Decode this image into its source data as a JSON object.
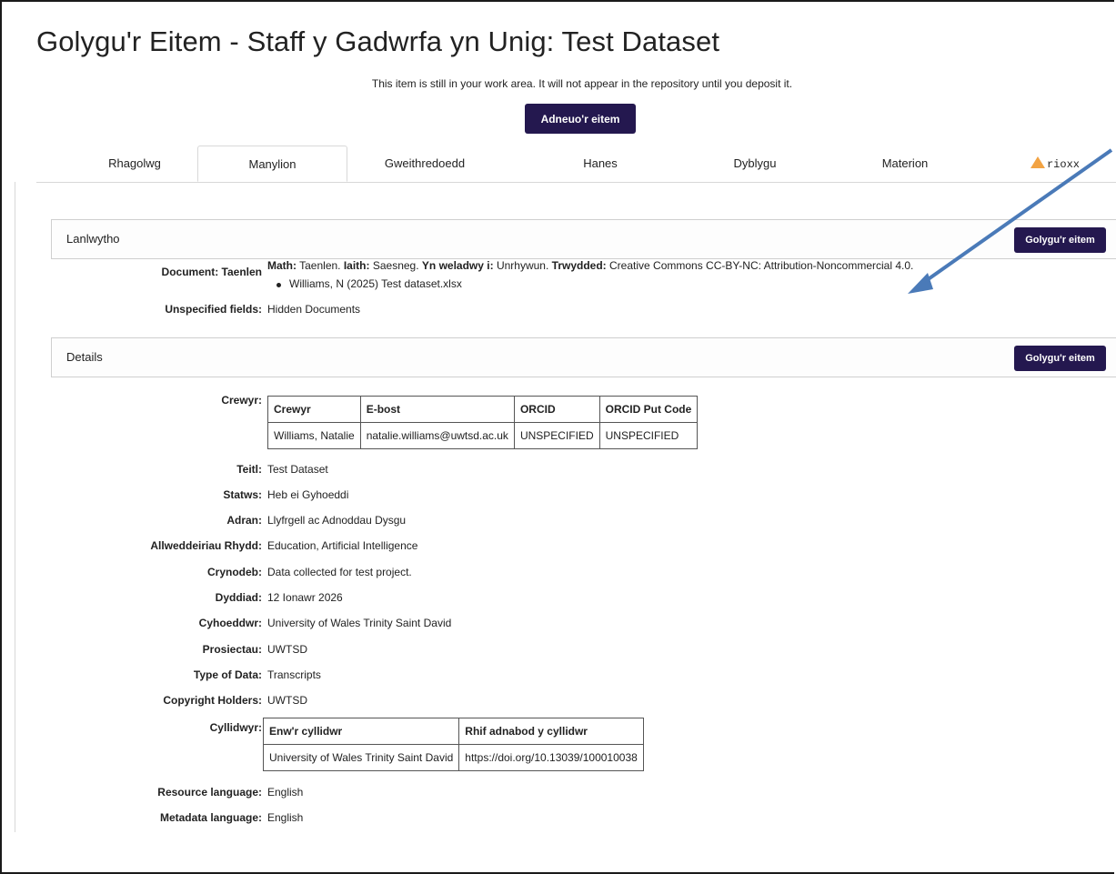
{
  "page": {
    "title": "Golygu'r Eitem - Staff y Gadwrfa yn Unig: Test Dataset",
    "notice": "This item is still in your work area. It will not appear in the repository until you deposit it.",
    "deposit_label": "Adneuo'r eitem"
  },
  "tabs": [
    {
      "label": "Rhagolwg"
    },
    {
      "label": "Manylion",
      "active": true
    },
    {
      "label": "Gweithredoedd"
    },
    {
      "label": "Hanes"
    },
    {
      "label": "Dyblygu"
    },
    {
      "label": "Materion"
    },
    {
      "label": "rioxx",
      "icon": "warning-icon"
    }
  ],
  "upload_panel": {
    "title": "Lanlwytho",
    "edit_label": "Golygu'r eitem",
    "document_label": "Document: Taenlen",
    "doc_line": {
      "math_label": "Math:",
      "math_value": "Taenlen.",
      "iaith_label": "Iaith:",
      "iaith_value": "Saesneg.",
      "visible_label": "Yn weladwy i:",
      "visible_value": "Unrhywun.",
      "license_label": "Trwydded:",
      "license_value": "Creative Commons CC-BY-NC: Attribution-Noncommercial 4.0."
    },
    "file_link": "Williams, N (2025) Test dataset.xlsx",
    "unspecified_label": "Unspecified fields:",
    "unspecified_value": "Hidden Documents"
  },
  "details_panel": {
    "title": "Details",
    "edit_label": "Golygu'r eitem",
    "creators_label": "Crewyr:",
    "creators_table": {
      "headers": [
        "Crewyr",
        "E-bost",
        "ORCID",
        "ORCID Put Code"
      ],
      "rows": [
        [
          "Williams, Natalie",
          "natalie.williams@uwtsd.ac.uk",
          "UNSPECIFIED",
          "UNSPECIFIED"
        ]
      ]
    },
    "fields": [
      {
        "label": "Teitl:",
        "value": "Test Dataset"
      },
      {
        "label": "Statws:",
        "value": "Heb ei Gyhoeddi"
      },
      {
        "label": "Adran:",
        "value": "Llyfrgell ac Adnoddau Dysgu"
      },
      {
        "label": "Allweddeiriau Rhydd:",
        "value": "Education, Artificial Intelligence"
      },
      {
        "label": "Crynodeb:",
        "value": "Data collected for test project."
      },
      {
        "label": "Dyddiad:",
        "value": "12 Ionawr 2026"
      },
      {
        "label": "Cyhoeddwr:",
        "value": "University of Wales Trinity Saint David"
      },
      {
        "label": "Prosiectau:",
        "value": "UWTSD"
      },
      {
        "label": "Type of Data:",
        "value": "Transcripts"
      },
      {
        "label": "Copyright Holders:",
        "value": "UWTSD"
      }
    ],
    "funders_label": "Cyllidwyr:",
    "funders_table": {
      "headers": [
        "Enw'r cyllidwr",
        "Rhif adnabod y cyllidwr"
      ],
      "rows": [
        [
          "University of Wales Trinity Saint David",
          "https://doi.org/10.13039/100010038"
        ]
      ]
    },
    "languages": [
      {
        "label": "Resource language:",
        "value": "English"
      },
      {
        "label": "Metadata language:",
        "value": "English"
      }
    ]
  },
  "colors": {
    "button": "#24184f",
    "warning": "#f2a343",
    "arrow": "#4a7ab8"
  }
}
